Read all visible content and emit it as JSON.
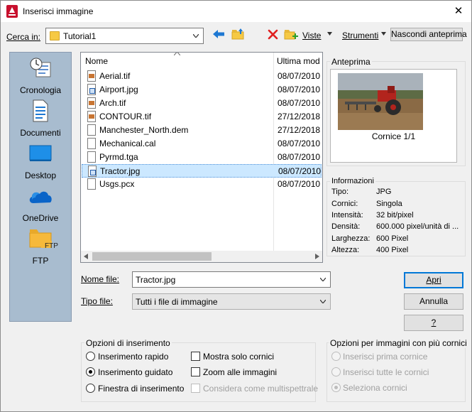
{
  "window": {
    "title": "Inserisci immagine",
    "close_glyph": "✕"
  },
  "toolbar": {
    "look_in_label": "Cerca in:",
    "look_in_value": "Tutorial1",
    "views_label": "Viste",
    "tools_label": "Strumenti",
    "hide_preview_label": "Nascondi anteprima"
  },
  "places": [
    {
      "label": "Cronologia",
      "icon": "history-icon"
    },
    {
      "label": "Documenti",
      "icon": "documents-icon"
    },
    {
      "label": "Desktop",
      "icon": "desktop-icon"
    },
    {
      "label": "OneDrive",
      "icon": "onedrive-icon"
    },
    {
      "label": "FTP",
      "icon": "ftp-folder-icon",
      "icon_text": "FTP"
    }
  ],
  "file_list": {
    "columns": [
      "Nome",
      "Ultima mod"
    ],
    "files": [
      {
        "name": "Aerial.tif",
        "date": "08/07/2010",
        "icon": "image-file-icon"
      },
      {
        "name": "Airport.jpg",
        "date": "08/07/2010",
        "icon": "jpg-file-icon"
      },
      {
        "name": "Arch.tif",
        "date": "08/07/2010",
        "icon": "image-file-icon"
      },
      {
        "name": "CONTOUR.tif",
        "date": "27/12/2018",
        "icon": "image-file-icon"
      },
      {
        "name": "Manchester_North.dem",
        "date": "27/12/2018",
        "icon": "blank-file-icon"
      },
      {
        "name": "Mechanical.cal",
        "date": "08/07/2010",
        "icon": "blank-file-icon"
      },
      {
        "name": "Pyrmd.tga",
        "date": "08/07/2010",
        "icon": "blank-file-icon"
      },
      {
        "name": "Tractor.jpg",
        "date": "08/07/2010",
        "icon": "jpg-file-icon",
        "selected": true
      },
      {
        "name": "Usgs.pcx",
        "date": "08/07/2010",
        "icon": "blank-file-icon"
      }
    ]
  },
  "preview": {
    "title": "Anteprima",
    "caption": "Cornice 1/1"
  },
  "info": {
    "title": "Informazioni",
    "rows": [
      {
        "key": "Tipo:",
        "value": "JPG"
      },
      {
        "key": "Cornici:",
        "value": "Singola"
      },
      {
        "key": "Intensità:",
        "value": "32 bit/pixel"
      },
      {
        "key": "Densità:",
        "value": "600.000 pixel/unità di ..."
      },
      {
        "key": "Larghezza:",
        "value": "600 Pixel"
      },
      {
        "key": "Altezza:",
        "value": "400 Pixel"
      }
    ]
  },
  "form": {
    "file_name_label": "Nome file:",
    "file_name_value": "Tractor.jpg",
    "file_type_label": "Tipo file:",
    "file_type_value": "Tutti i file di immagine"
  },
  "buttons": {
    "open": "Apri",
    "cancel": "Annulla",
    "help": "?"
  },
  "insert_options": {
    "title": "Opzioni di inserimento",
    "quick": "Inserimento rapido",
    "guided": "Inserimento guidato",
    "window": "Finestra di inserimento",
    "selected": "guided",
    "show_frames_only": "Mostra solo cornici",
    "zoom_to_images": "Zoom alle immagini",
    "multispectral": "Considera come multispettrale"
  },
  "multi_frame": {
    "title": "Opzioni per immagini con più cornici",
    "first": "Inserisci prima cornice",
    "all": "Inserisci tutte le cornici",
    "select": "Seleziona cornici",
    "selected": "select"
  },
  "colors": {
    "accent": "#0078d7",
    "places_bg": "#a8bccf",
    "selection": "#cce8ff"
  }
}
